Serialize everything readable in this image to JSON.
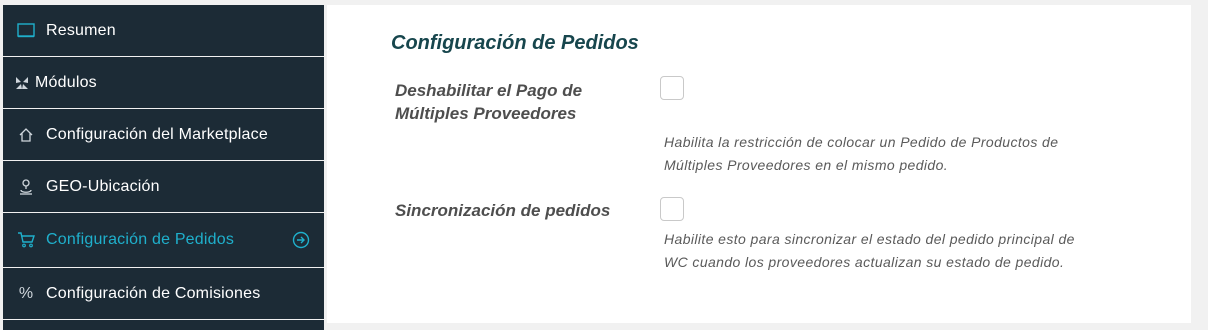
{
  "sidebar": {
    "items": [
      {
        "label": "Resumen",
        "icon": "monitor-icon"
      },
      {
        "label": "Módulos",
        "icon": "modules-icon"
      },
      {
        "label": "Configuración del Marketplace",
        "icon": "home-icon"
      },
      {
        "label": "GEO-Ubicación",
        "icon": "location-icon"
      },
      {
        "label": "Configuración de Pedidos",
        "icon": "cart-icon",
        "active": true
      },
      {
        "label": "Configuración de Comisiones",
        "icon": "percent-icon"
      }
    ],
    "active_color": "#1fb0cc",
    "background": "#1c2b36"
  },
  "main": {
    "title": "Configuración de Pedidos",
    "options": [
      {
        "label_line1": "Deshabilitar el Pago de",
        "label_line2": "Múltiples Proveedores",
        "checked": false,
        "description_line1": "Habilita la restricción de colocar un Pedido de Productos de",
        "description_line2": "Múltiples Proveedores en el mismo pedido."
      },
      {
        "label_line1": "Sincronización de pedidos",
        "checked": false,
        "description_line1": "Habilite esto para sincronizar el estado del pedido principal de",
        "description_line2": "WC cuando los proveedores actualizan su estado de pedido."
      }
    ]
  }
}
